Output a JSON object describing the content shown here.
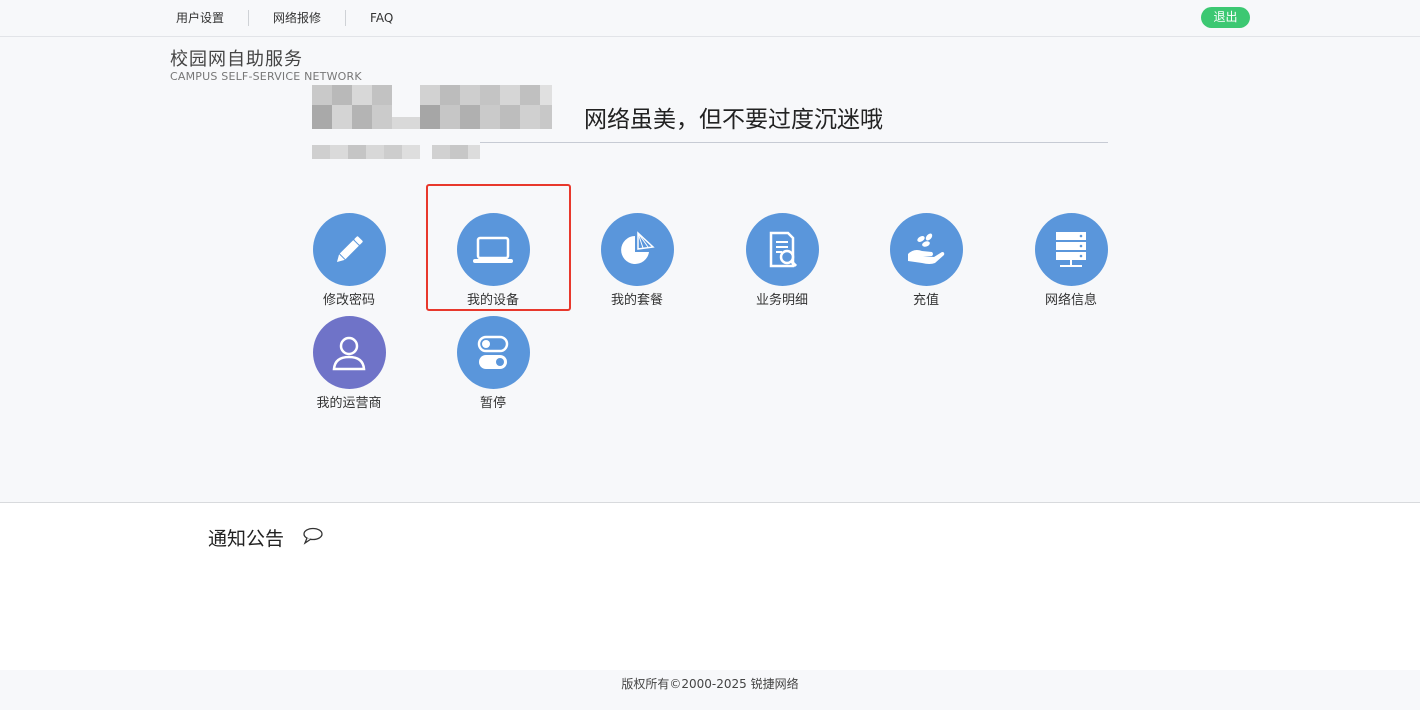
{
  "nav": {
    "items": [
      "用户设置",
      "网络报修",
      "FAQ"
    ],
    "logout_label": "退出"
  },
  "brand": {
    "title": "校园网自助服务",
    "subtitle": "CAMPUS  SELF-SERVICE NETWORK"
  },
  "slogan": "网络虽美，但不要过度沉迷哦",
  "tiles": [
    {
      "label": "修改密码",
      "icon": "pencil-icon"
    },
    {
      "label": "我的设备",
      "icon": "laptop-icon"
    },
    {
      "label": "我的套餐",
      "icon": "pie-chart-icon"
    },
    {
      "label": "业务明细",
      "icon": "document-search-icon"
    },
    {
      "label": "充值",
      "icon": "hand-coins-icon"
    },
    {
      "label": "网络信息",
      "icon": "server-icon"
    },
    {
      "label": "我的运营商",
      "icon": "user-icon"
    },
    {
      "label": "暂停",
      "icon": "toggle-icon"
    }
  ],
  "notice": {
    "title": "通知公告"
  },
  "footer": {
    "copyright": "版权所有©2000-2025 锐捷网络"
  },
  "colors": {
    "accent_blue": "#5a96db",
    "accent_purple": "#6f73c8",
    "logout_green": "#3cc872",
    "highlight_red": "#e8382c"
  }
}
